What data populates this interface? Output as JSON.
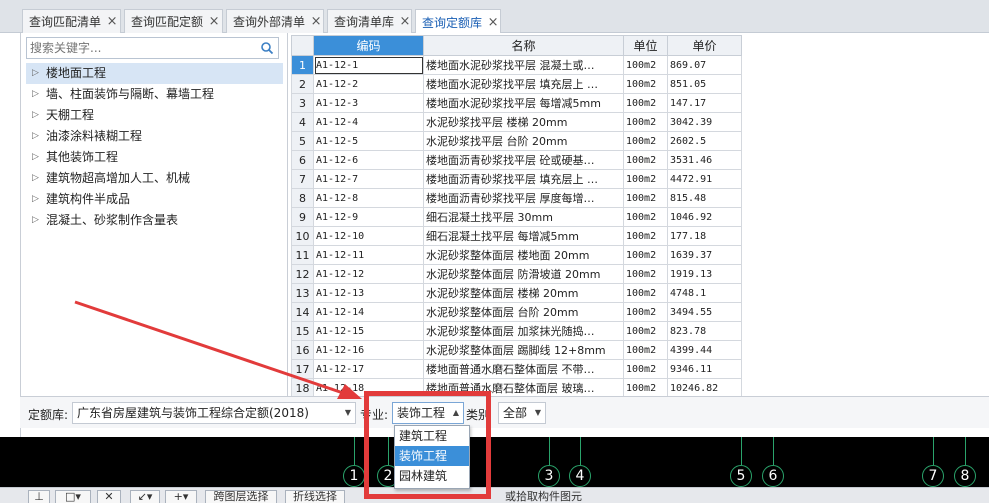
{
  "tabs": [
    {
      "label": "查询匹配清单"
    },
    {
      "label": "查询匹配定额"
    },
    {
      "label": "查询外部清单"
    },
    {
      "label": "查询清单库"
    },
    {
      "label": "查询定额库"
    }
  ],
  "search": {
    "placeholder": "搜索关键字..."
  },
  "tree": {
    "items": [
      {
        "label": "楼地面工程"
      },
      {
        "label": "墙、柱面装饰与隔断、幕墙工程"
      },
      {
        "label": "天棚工程"
      },
      {
        "label": "油漆涂料裱糊工程"
      },
      {
        "label": "其他装饰工程"
      },
      {
        "label": "建筑物超高增加人工、机械"
      },
      {
        "label": "建筑构件半成品"
      },
      {
        "label": "混凝土、砂浆制作含量表"
      }
    ]
  },
  "grid": {
    "headers": {
      "code": "编码",
      "name": "名称",
      "unit": "单位",
      "price": "单价"
    },
    "rows": [
      {
        "n": "1",
        "code": "A1-12-1",
        "name": "楼地面水泥砂浆找平层 混凝土或…",
        "unit": "100m2",
        "price": "869.07"
      },
      {
        "n": "2",
        "code": "A1-12-2",
        "name": "楼地面水泥砂浆找平层 填充层上 …",
        "unit": "100m2",
        "price": "851.05"
      },
      {
        "n": "3",
        "code": "A1-12-3",
        "name": "楼地面水泥砂浆找平层 每增减5mm",
        "unit": "100m2",
        "price": "147.17"
      },
      {
        "n": "4",
        "code": "A1-12-4",
        "name": "水泥砂浆找平层 楼梯 20mm",
        "unit": "100m2",
        "price": "3042.39"
      },
      {
        "n": "5",
        "code": "A1-12-5",
        "name": "水泥砂浆找平层 台阶 20mm",
        "unit": "100m2",
        "price": "2602.5"
      },
      {
        "n": "6",
        "code": "A1-12-6",
        "name": "楼地面沥青砂浆找平层 砼或硬基…",
        "unit": "100m2",
        "price": "3531.46"
      },
      {
        "n": "7",
        "code": "A1-12-7",
        "name": "楼地面沥青砂浆找平层 填充层上 …",
        "unit": "100m2",
        "price": "4472.91"
      },
      {
        "n": "8",
        "code": "A1-12-8",
        "name": "楼地面沥青砂浆找平层 厚度每增…",
        "unit": "100m2",
        "price": "815.48"
      },
      {
        "n": "9",
        "code": "A1-12-9",
        "name": "细石混凝土找平层 30mm",
        "unit": "100m2",
        "price": "1046.92"
      },
      {
        "n": "10",
        "code": "A1-12-10",
        "name": "细石混凝土找平层 每增减5mm",
        "unit": "100m2",
        "price": "177.18"
      },
      {
        "n": "11",
        "code": "A1-12-11",
        "name": "水泥砂浆整体面层 楼地面 20mm",
        "unit": "100m2",
        "price": "1639.37"
      },
      {
        "n": "12",
        "code": "A1-12-12",
        "name": "水泥砂浆整体面层 防滑坡道 20mm",
        "unit": "100m2",
        "price": "1919.13"
      },
      {
        "n": "13",
        "code": "A1-12-13",
        "name": "水泥砂浆整体面层 楼梯 20mm",
        "unit": "100m2",
        "price": "4748.1"
      },
      {
        "n": "14",
        "code": "A1-12-14",
        "name": "水泥砂浆整体面层 台阶 20mm",
        "unit": "100m2",
        "price": "3494.55"
      },
      {
        "n": "15",
        "code": "A1-12-15",
        "name": "水泥砂浆整体面层 加浆抹光随捣…",
        "unit": "100m2",
        "price": "823.78"
      },
      {
        "n": "16",
        "code": "A1-12-16",
        "name": "水泥砂浆整体面层 踢脚线 12+8mm",
        "unit": "100m2",
        "price": "4399.44"
      },
      {
        "n": "17",
        "code": "A1-12-17",
        "name": "楼地面普通水磨石整体面层 不带…",
        "unit": "100m2",
        "price": "9346.11"
      },
      {
        "n": "18",
        "code": "A1-12-18",
        "name": "楼地面普通水磨石整体面层 玻璃…",
        "unit": "100m2",
        "price": "10246.82"
      }
    ]
  },
  "filter": {
    "quota_label": "定额库:",
    "quota_value": "广东省房屋建筑与装饰工程综合定额(2018)",
    "major_label": "专业:",
    "major_value": "装饰工程",
    "category_label": "类别",
    "category_value": "全部"
  },
  "dropdown": {
    "options": [
      {
        "label": "建筑工程"
      },
      {
        "label": "装饰工程"
      },
      {
        "label": "园林建筑"
      }
    ]
  },
  "axes": {
    "labels": [
      "1",
      "2",
      "3",
      "4",
      "5",
      "6",
      "7",
      "8"
    ]
  },
  "toolbar": {
    "btn_layer": "跨图层选择",
    "btn_polyline": "折线选择",
    "status": "或拾取构件图元"
  },
  "colors": {
    "highlight": "#e23b3b",
    "selection": "#3b8fd9",
    "axis": "#2aa36b"
  }
}
